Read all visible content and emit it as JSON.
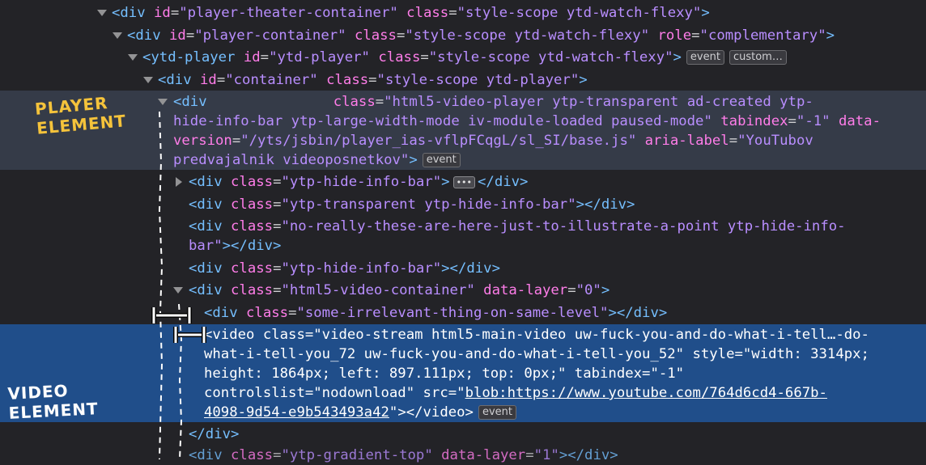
{
  "annotations": {
    "player_line1": "PLAYER",
    "player_line2": "ELEMENT",
    "video_line1": "VIDEO",
    "video_line2": "ELEMENT"
  },
  "colors": {
    "tag": "#75bfff",
    "attribute": "#ff7de9",
    "value": "#b98eff",
    "punctuation": "#cfcfd2",
    "selected_row_gray": "#353b48",
    "selected_row_blue": "#204e8a",
    "player_label": "#f5c33b"
  },
  "dom": {
    "l1": {
      "open": "<div",
      "id_attr": "id",
      "id_val": "\"player-theater-container\"",
      "class_attr": "class",
      "class_val": "\"style-scope ytd-watch-flexy\"",
      "close": ">"
    },
    "l2": {
      "open": "<div",
      "id_attr": "id",
      "id_val": "\"player-container\"",
      "class_attr": "class",
      "class_val": "\"style-scope ytd-watch-flexy\"",
      "role_attr": "role",
      "role_val": "\"complementary\"",
      "close": ">"
    },
    "l3": {
      "open": "<ytd-player",
      "id_attr": "id",
      "id_val": "\"ytd-player\"",
      "class_attr": "class",
      "class_val": "\"style-scope ytd-watch-flexy\"",
      "close": ">",
      "badge1": "event",
      "badge2": "custom…"
    },
    "l4": {
      "open": "<div",
      "id_attr": "id",
      "id_val": "\"container\"",
      "class_attr": "class",
      "class_val": "\"style-scope ytd-player\"",
      "close": ">"
    },
    "l5": {
      "open": "<div",
      "class_attr": "class",
      "class_val_a": "\"html5-video-player ytp-transparent ad-created ytp-",
      "class_val_b": "hide-info-bar ytp-large-width-mode iv-module-loaded paused-mode\"",
      "tabindex_attr": "tabindex",
      "tabindex_val": "\"-1\"",
      "dv_attr_a": "data-",
      "dv_attr_b": "version",
      "dv_val": "\"/yts/jsbin/player_ias-vflpFCqgL/sl_SI/base.js\"",
      "aria_attr": "aria-label",
      "aria_val_a": "\"YouTubov",
      "aria_val_b": "predvajalnik videoposnetkov\"",
      "close": ">",
      "badge": "event"
    },
    "l6": {
      "open": "<div",
      "class_attr": "class",
      "class_val": "\"ytp-hide-info-bar\"",
      "close": ">",
      "dots": "•••",
      "end": "</div>"
    },
    "l7": {
      "open": "<div",
      "class_attr": "class",
      "class_val": "\"ytp-transparent ytp-hide-info-bar\"",
      "close": "></div>"
    },
    "l8": {
      "open": "<div",
      "class_attr": "class",
      "class_val_a": "\"no-really-these-are-here-just-to-illustrate-a-point ytp-hide-info-",
      "class_val_b": "bar\"",
      "close": "></div>"
    },
    "l9": {
      "open": "<div",
      "class_attr": "class",
      "class_val": "\"ytp-hide-info-bar\"",
      "close": "></div>"
    },
    "l10": {
      "open": "<div",
      "class_attr": "class",
      "class_val": "\"html5-video-container\"",
      "layer_attr": "data-layer",
      "layer_val": "\"0\"",
      "close": ">"
    },
    "l11": {
      "open": "<div",
      "class_attr": "class",
      "class_val": "\"some-irrelevant-thing-on-same-level\"",
      "close": "></div>"
    },
    "l12": {
      "open": "<video",
      "class_attr": "class",
      "class_val_a": "\"video-stream html5-main-video uw-fuck-you-and-do-what-i-tell…-do-",
      "class_val_b": "what-i-tell-you_72 uw-fuck-you-and-do-what-i-tell-you_52\"",
      "style_attr": "style",
      "style_val_a": "\"width: 3314px;",
      "style_val_b": "height: 1864px; left: 897.111px; top: 0px;\"",
      "tabindex_attr": "tabindex",
      "tabindex_val": "\"-1\"",
      "controls_attr": "controlslist",
      "controls_val": "\"nodownload\"",
      "src_attr": "src",
      "src_val_a": "\"",
      "src_link_a": "blob:https://www.youtube.com/764d6cd4-667b-",
      "src_link_b": "4098-9d54-e9b543493a42",
      "src_val_b": "\"",
      "close": "></video>",
      "badge": "event"
    },
    "l13": {
      "end": "</div>"
    },
    "l14": {
      "open": "<div",
      "class_attr": "class",
      "class_val": "\"ytp-gradient-top\"",
      "layer_attr": "data-layer",
      "layer_val": "\"1\"",
      "close": "></div>"
    }
  }
}
